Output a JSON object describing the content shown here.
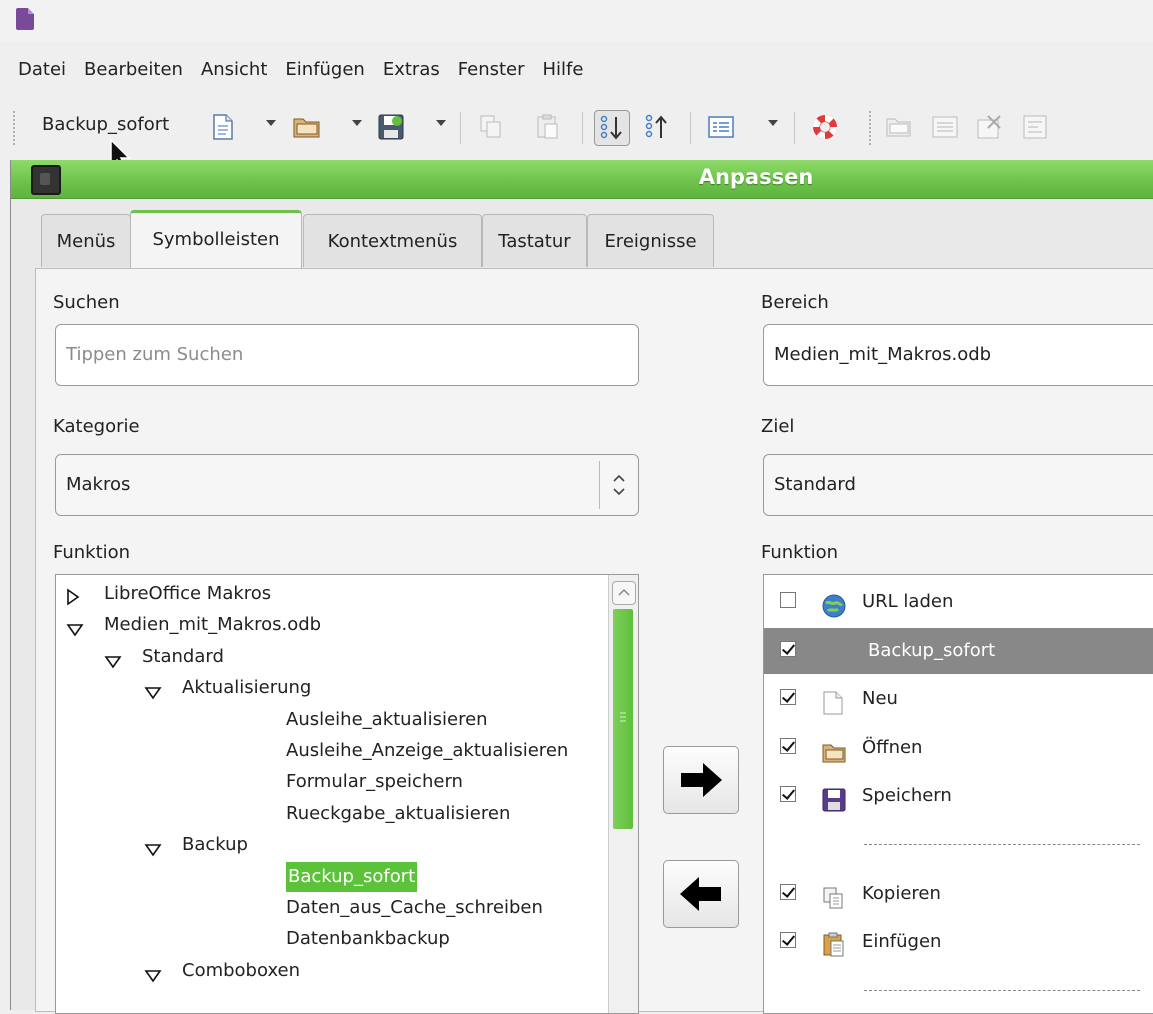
{
  "menubar": {
    "items": [
      {
        "label": "Datei",
        "name": "menu-datei"
      },
      {
        "label": "Bearbeiten",
        "name": "menu-bearbeiten"
      },
      {
        "label": "Ansicht",
        "name": "menu-ansicht"
      },
      {
        "label": "Einfügen",
        "name": "menu-einfuegen"
      },
      {
        "label": "Extras",
        "name": "menu-extras"
      },
      {
        "label": "Fenster",
        "name": "menu-fenster"
      },
      {
        "label": "Hilfe",
        "name": "menu-hilfe"
      }
    ]
  },
  "toolbar": {
    "macro_button_label": "Backup_sofort",
    "icons": [
      "new-document-icon",
      "open-folder-icon",
      "save-icon",
      "copy-icon",
      "paste-icon",
      "sort-ascending-icon",
      "sort-descending-icon",
      "form-view-icon",
      "help-lifebuoy-icon",
      "open-folder-icon",
      "table-view-icon",
      "delete-record-icon",
      "form-edit-icon"
    ]
  },
  "dialog": {
    "title": "Anpassen",
    "tabs": [
      "Menüs",
      "Symbolleisten",
      "Kontextmenüs",
      "Tastatur",
      "Ereignisse"
    ],
    "active_tab": "Symbolleisten",
    "search": {
      "label": "Suchen",
      "placeholder": "Tippen zum Suchen",
      "value": ""
    },
    "category": {
      "label": "Kategorie",
      "value": "Makros"
    },
    "function_label_left": "Funktion",
    "range": {
      "label": "Bereich",
      "value": "Medien_mit_Makros.odb"
    },
    "target": {
      "label": "Ziel",
      "value": "Standard"
    },
    "function_label_right": "Funktion",
    "tree": [
      {
        "label": "LibreOffice Makros",
        "level": 0,
        "expander": "collapsed"
      },
      {
        "label": "Medien_mit_Makros.odb",
        "level": 0,
        "expander": "expanded"
      },
      {
        "label": "Standard",
        "level": 1,
        "expander": "expanded"
      },
      {
        "label": "Aktualisierung",
        "level": 2,
        "expander": "expanded"
      },
      {
        "label": "Ausleihe_aktualisieren",
        "level": 3,
        "expander": "none"
      },
      {
        "label": "Ausleihe_Anzeige_aktualisieren",
        "level": 3,
        "expander": "none"
      },
      {
        "label": "Formular_speichern",
        "level": 3,
        "expander": "none"
      },
      {
        "label": "Rueckgabe_aktualisieren",
        "level": 3,
        "expander": "none"
      },
      {
        "label": "Backup",
        "level": 2,
        "expander": "expanded"
      },
      {
        "label": "Backup_sofort",
        "level": 3,
        "expander": "none",
        "highlighted": true
      },
      {
        "label": "Daten_aus_Cache_schreiben",
        "level": 3,
        "expander": "none"
      },
      {
        "label": "Datenbankbackup",
        "level": 3,
        "expander": "none"
      },
      {
        "label": "Comboboxen",
        "level": 2,
        "expander": "expanded"
      }
    ],
    "entries": [
      {
        "label": "URL laden",
        "checked": false,
        "icon": "globe-icon"
      },
      {
        "label": "Backup_sofort",
        "checked": true,
        "icon": "",
        "selected": true
      },
      {
        "label": "Neu",
        "checked": true,
        "icon": "new-document-icon"
      },
      {
        "label": "Öffnen",
        "checked": true,
        "icon": "open-folder-icon"
      },
      {
        "label": "Speichern",
        "checked": true,
        "icon": "save-icon"
      },
      {
        "separator": true
      },
      {
        "label": "Kopieren",
        "checked": true,
        "icon": "copy-icon"
      },
      {
        "label": "Einfügen",
        "checked": true,
        "icon": "paste-icon"
      },
      {
        "separator": true
      }
    ]
  }
}
